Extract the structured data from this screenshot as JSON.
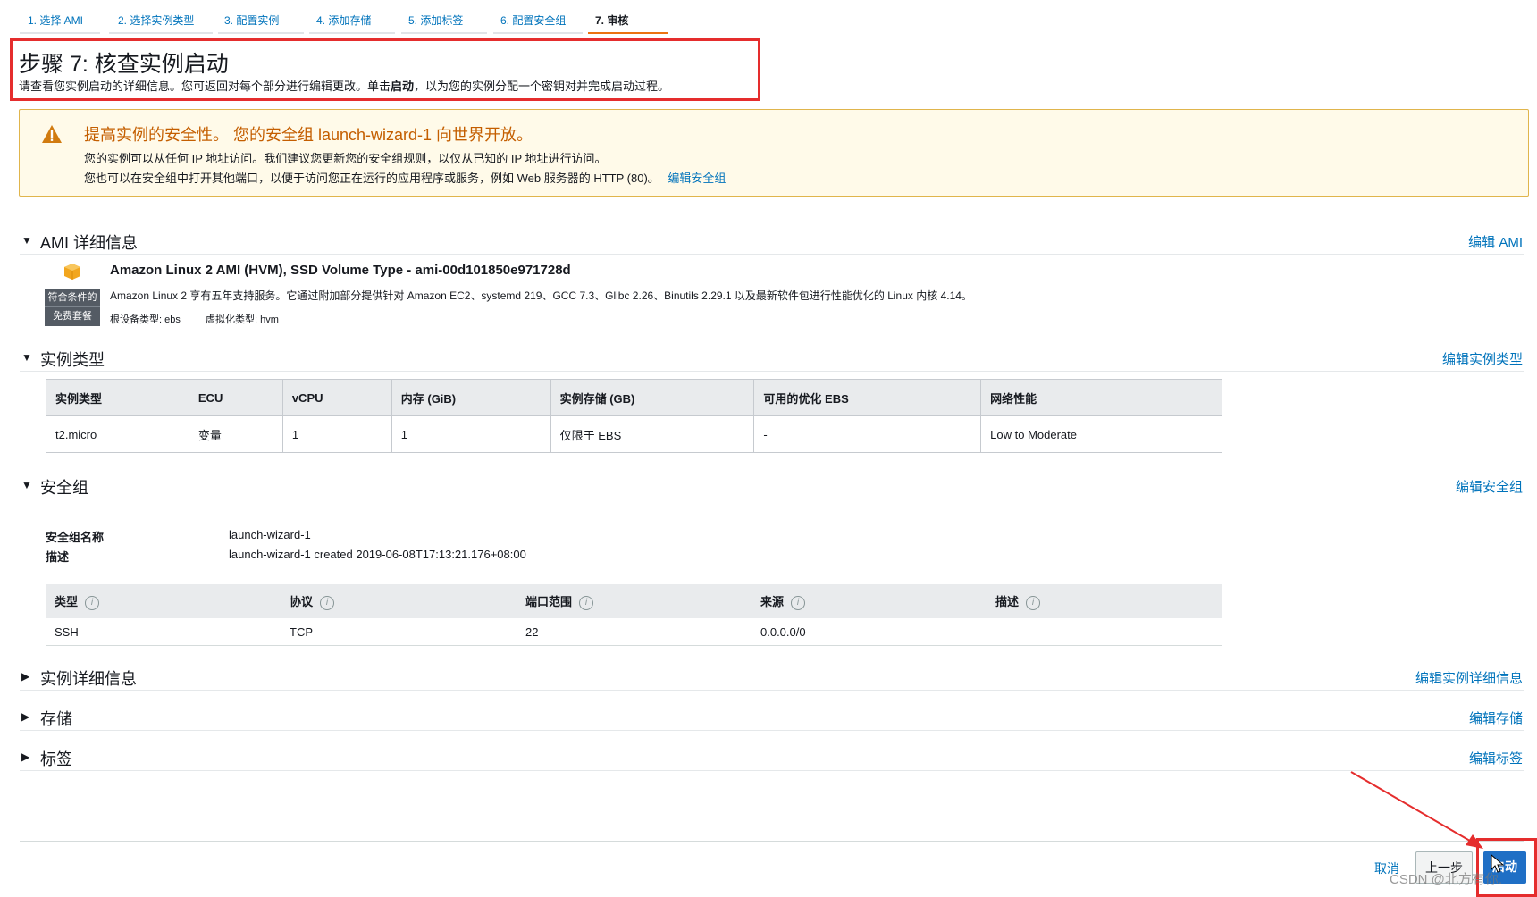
{
  "tabs": [
    {
      "label": "1. 选择 AMI"
    },
    {
      "label": "2. 选择实例类型"
    },
    {
      "label": "3. 配置实例"
    },
    {
      "label": "4. 添加存储"
    },
    {
      "label": "5. 添加标签"
    },
    {
      "label": "6. 配置安全组"
    },
    {
      "label": "7. 审核"
    }
  ],
  "header": {
    "title": "步骤 7: 核查实例启动",
    "desc_pre": "请查看您实例启动的详细信息。您可返回对每个部分进行编辑更改。单击",
    "desc_bold": "启动",
    "desc_post": "，以为您的实例分配一个密钥对并完成启动过程。"
  },
  "warning": {
    "title": "提高实例的安全性。 您的安全组 launch-wizard-1 向世界开放。",
    "line1": "您的实例可以从任何 IP 地址访问。我们建议您更新您的安全组规则，以仅从已知的 IP 地址进行访问。",
    "line2": "您也可以在安全组中打开其他端口，以便于访问您正在运行的应用程序或服务，例如 Web 服务器的 HTTP (80)。",
    "link": "编辑安全组"
  },
  "ami_section": {
    "title": "AMI 详细信息",
    "edit": "编辑 AMI",
    "name": "Amazon Linux 2 AMI (HVM), SSD Volume Type - ami-00d101850e971728d",
    "badge_line1": "符合条件的",
    "badge_line2": "免费套餐",
    "desc": "Amazon Linux 2 享有五年支持服务。它通过附加部分提供针对 Amazon EC2、systemd 219、GCC 7.3、Glibc 2.26、Binutils 2.29.1 以及最新软件包进行性能优化的 Linux 内核 4.14。",
    "root_device": "根设备类型: ebs",
    "virt_type": "虚拟化类型: hvm"
  },
  "instance_section": {
    "title": "实例类型",
    "edit": "编辑实例类型",
    "headers": [
      "实例类型",
      "ECU",
      "vCPU",
      "内存 (GiB)",
      "实例存储 (GB)",
      "可用的优化 EBS",
      "网络性能"
    ],
    "row": [
      "t2.micro",
      "变量",
      "1",
      "1",
      "仅限于 EBS",
      "-",
      "Low to Moderate"
    ]
  },
  "sg_section": {
    "title": "安全组",
    "edit": "编辑安全组",
    "name_label": "安全组名称",
    "name_value": "launch-wizard-1",
    "desc_label": "描述",
    "desc_value": "launch-wizard-1 created 2019-06-08T17:13:21.176+08:00",
    "headers": [
      "类型",
      "协议",
      "端口范围",
      "来源",
      "描述"
    ],
    "row": [
      "SSH",
      "TCP",
      "22",
      "0.0.0.0/0",
      ""
    ]
  },
  "collapsed_sections": [
    {
      "title": "实例详细信息",
      "edit": "编辑实例详细信息"
    },
    {
      "title": "存储",
      "edit": "编辑存储"
    },
    {
      "title": "标签",
      "edit": "编辑标签"
    }
  ],
  "footer": {
    "cancel": "取消",
    "previous": "上一步",
    "launch": "启动"
  },
  "watermark": "CSDN @北方有你.",
  "colors": {
    "link": "#0073bb",
    "warning_title": "#c45e00",
    "warning_bg": "#fffae9",
    "active_tab": "#ec7211",
    "annotation_red": "#e52d2d",
    "launch_button": "#1f6fc5"
  }
}
